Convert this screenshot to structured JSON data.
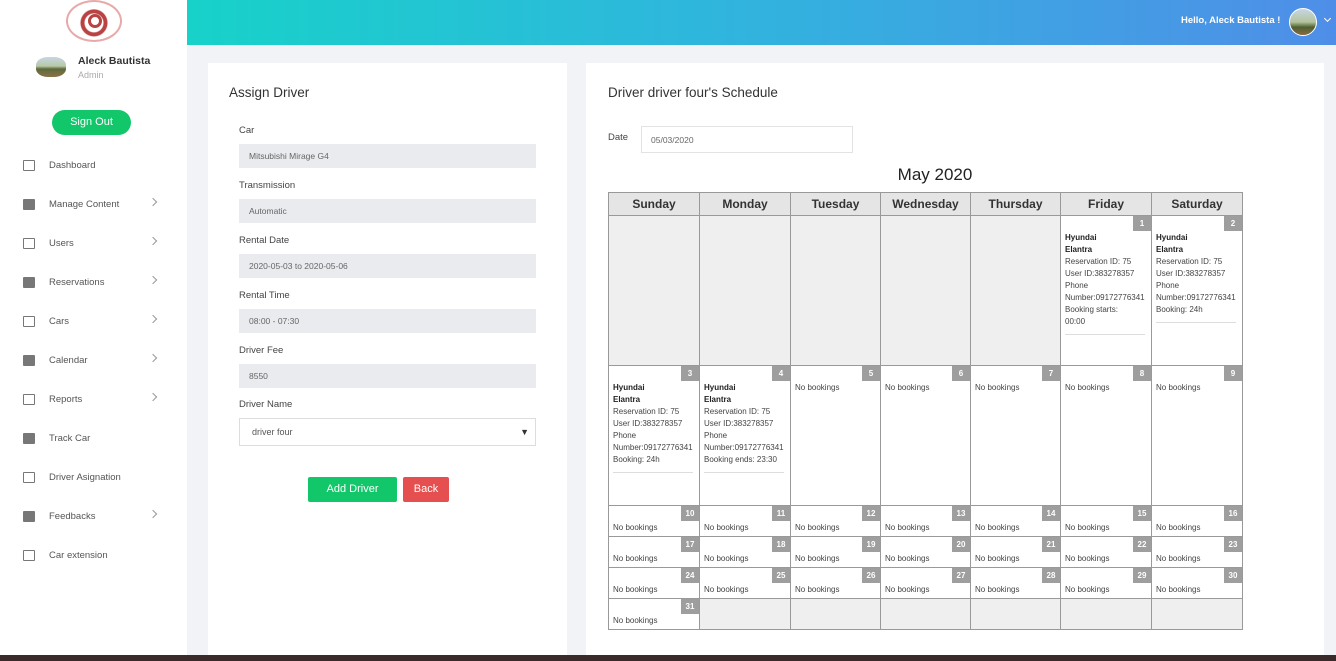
{
  "header": {
    "greeting": "Hello, Aleck Bautista !"
  },
  "sidebar": {
    "user_name": "Aleck Bautista",
    "user_role": "Admin",
    "sign_out": "Sign Out",
    "items": [
      {
        "label": "Dashboard",
        "icon": "monitor-icon",
        "chevron": false
      },
      {
        "label": "Manage Content",
        "icon": "content-icon",
        "chevron": true
      },
      {
        "label": "Users",
        "icon": "users-icon",
        "chevron": true
      },
      {
        "label": "Reservations",
        "icon": "bookmark-icon",
        "chevron": true
      },
      {
        "label": "Cars",
        "icon": "car-icon",
        "chevron": true
      },
      {
        "label": "Calendar",
        "icon": "calendar-icon",
        "chevron": true
      },
      {
        "label": "Reports",
        "icon": "chart-icon",
        "chevron": true
      },
      {
        "label": "Track Car",
        "icon": "map-icon",
        "chevron": false
      },
      {
        "label": "Driver Asignation",
        "icon": "id-card-icon",
        "chevron": false
      },
      {
        "label": "Feedbacks",
        "icon": "feedback-icon",
        "chevron": true
      },
      {
        "label": "Car extension",
        "icon": "map-icon",
        "chevron": false
      }
    ]
  },
  "form": {
    "title": "Assign Driver",
    "car_label": "Car",
    "car_value": "Mitsubishi Mirage G4",
    "transmission_label": "Transmission",
    "transmission_value": "Automatic",
    "rental_date_label": "Rental Date",
    "rental_date_value": "2020-05-03 to 2020-05-06",
    "rental_time_label": "Rental Time",
    "rental_time_value": "08:00 - 07:30",
    "driver_fee_label": "Driver Fee",
    "driver_fee_value": "8550",
    "driver_name_label": "Driver Name",
    "driver_name_value": "driver four",
    "add_button": "Add Driver",
    "back_button": "Back"
  },
  "schedule": {
    "title": "Driver driver four's Schedule",
    "date_label": "Date",
    "date_value": "05/03/2020",
    "month": "May 2020",
    "weekdays": [
      "Sunday",
      "Monday",
      "Tuesday",
      "Wednesday",
      "Thursday",
      "Friday",
      "Saturday"
    ],
    "no_bookings_text": "No bookings",
    "bookings": {
      "1": [
        "Hyundai",
        "Elantra",
        "Reservation ID: 75",
        "User ID:383278357",
        "Phone",
        "Number:09172776341",
        "Booking starts:",
        "00:00"
      ],
      "2": [
        "Hyundai",
        "Elantra",
        "Reservation ID: 75",
        "User ID:383278357",
        "Phone",
        "Number:09172776341",
        "Booking: 24h"
      ],
      "3": [
        "Hyundai",
        "Elantra",
        "Reservation ID: 75",
        "User ID:383278357",
        "Phone",
        "Number:09172776341",
        "Booking: 24h"
      ],
      "4": [
        "Hyundai",
        "Elantra",
        "Reservation ID: 75",
        "User ID:383278357",
        "Phone",
        "Number:09172776341",
        "Booking ends: 23:30"
      ]
    }
  },
  "colors": {
    "accent_green": "#12c76a",
    "back_red": "#e54f4f",
    "topbar_start": "#17d2c9",
    "topbar_end": "#4f8ee8"
  }
}
